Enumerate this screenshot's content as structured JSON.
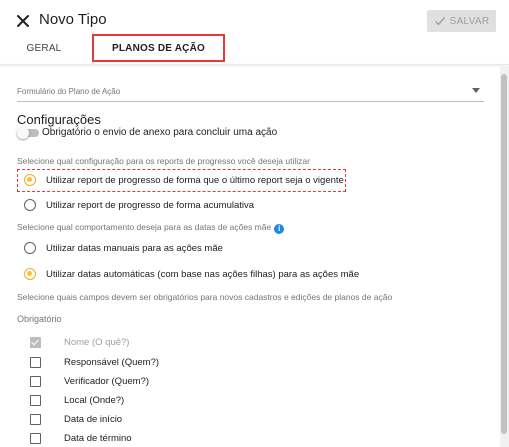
{
  "header": {
    "title": "Novo Tipo",
    "save_label": "SALVAR",
    "close_icon": "close-icon",
    "save_icon": "check-icon"
  },
  "tabs": [
    {
      "label": "GERAL",
      "active": false
    },
    {
      "label": "PLANOS DE AÇÃO",
      "active": true
    }
  ],
  "form": {
    "plan_select_label": "Formulário do Plano de Ação",
    "section_title": "Configurações",
    "attachment_toggle": {
      "label": "Obrigatório o envio de anexo para concluir uma ação",
      "on": false
    },
    "progress_question": "Selecione qual configuração para os reports de progresso você deseja utilizar",
    "progress_options": [
      {
        "label": "Utilizar report de progresso de forma que o último report seja o vigente",
        "checked": true
      },
      {
        "label": "Utilizar report de progresso de forma acumulativa",
        "checked": false
      }
    ],
    "dates_question": "Selecione qual comportamento deseja para as datas de ações mãe",
    "dates_options": [
      {
        "label": "Utilizar datas manuais para as ações mãe",
        "checked": false
      },
      {
        "label": "Utilizar datas automáticas (com base nas ações filhas) para as ações mãe",
        "checked": true
      }
    ],
    "fields_question": "Selecione quais campos devem ser obrigatórios para novos cadastros e edições de planos de ação",
    "required_label": "Obrigatório",
    "required_fields": [
      {
        "label": "Nome (O quê?)",
        "checked": true,
        "disabled": true
      },
      {
        "label": "Responsável (Quem?)",
        "checked": false,
        "disabled": false
      },
      {
        "label": "Verificador (Quem?)",
        "checked": false,
        "disabled": false
      },
      {
        "label": "Local (Onde?)",
        "checked": false,
        "disabled": false
      },
      {
        "label": "Data de início",
        "checked": false,
        "disabled": false
      },
      {
        "label": "Data de término",
        "checked": false,
        "disabled": false
      }
    ]
  },
  "colors": {
    "accent": "#fbc02d",
    "highlight_border": "#e53935",
    "info": "#1e88e5"
  }
}
